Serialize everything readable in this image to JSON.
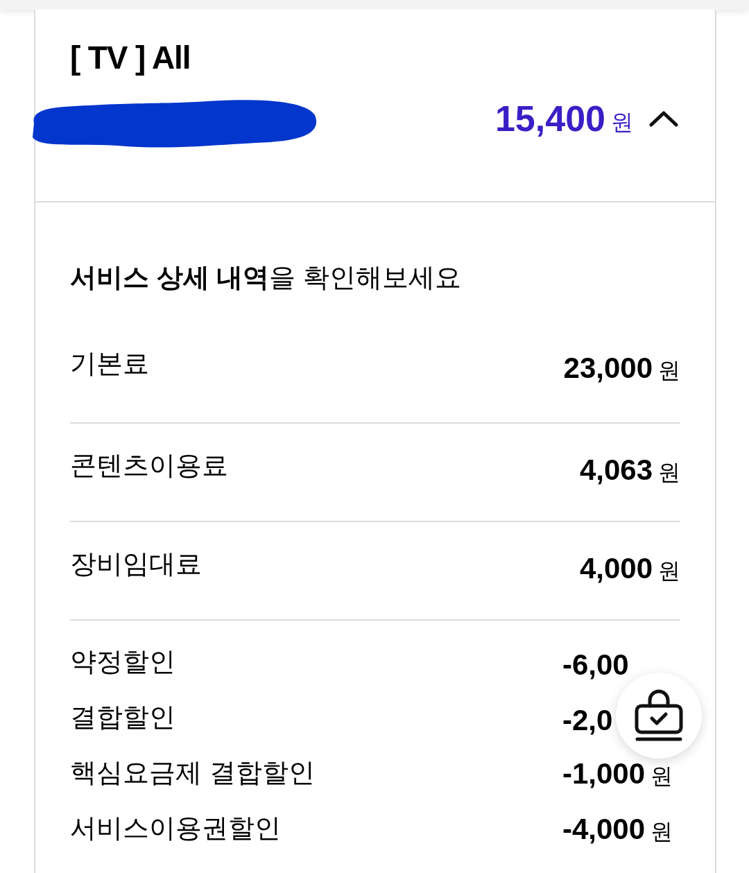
{
  "product": {
    "title": "[ TV ] All",
    "total": {
      "amount": "15,400",
      "unit": "원"
    },
    "expanded": true
  },
  "details": {
    "heading": "**서비스 상세 내역**을 확인해보세요",
    "charges": [
      {
        "label": "기본료",
        "amount": "23,000",
        "unit": "원"
      },
      {
        "label": "콘텐츠이용료",
        "amount": "4,063",
        "unit": "원"
      },
      {
        "label": "장비임대료",
        "amount": "4,000",
        "unit": "원"
      }
    ],
    "discounts": [
      {
        "label": "약정할인",
        "amount": "-6,00"
      },
      {
        "label": "결합할인",
        "amount": "-2,0"
      },
      {
        "label": "핵심요금제 결합할인",
        "amount": "-1,000",
        "unit": "원"
      },
      {
        "label": "서비스이용권할인",
        "amount": "-4,000",
        "unit": "원"
      }
    ]
  }
}
